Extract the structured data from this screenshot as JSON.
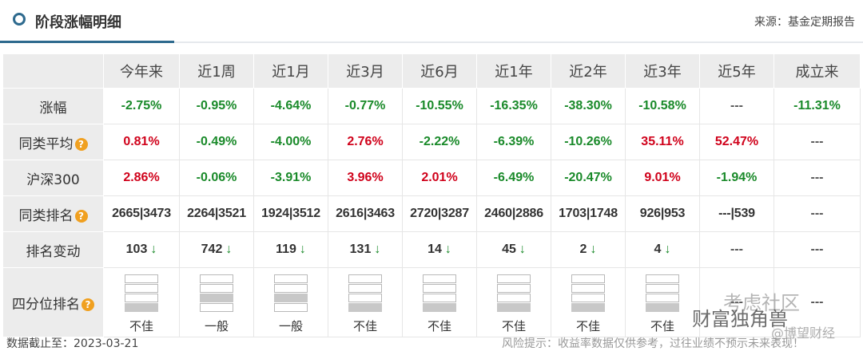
{
  "header": {
    "title": "阶段涨幅明细",
    "source": "来源：基金定期报告"
  },
  "columns": [
    "今年来",
    "近1周",
    "近1月",
    "近3月",
    "近6月",
    "近1年",
    "近2年",
    "近3年",
    "近5年",
    "成立来"
  ],
  "rows": {
    "gain": {
      "label": "涨幅",
      "values": [
        "-2.75%",
        "-0.95%",
        "-4.64%",
        "-0.77%",
        "-10.55%",
        "-16.35%",
        "-38.30%",
        "-10.58%",
        "---",
        "-11.31%"
      ]
    },
    "avg": {
      "label": "同类平均",
      "values": [
        "0.81%",
        "-0.49%",
        "-4.00%",
        "2.76%",
        "-2.22%",
        "-6.39%",
        "-10.26%",
        "35.11%",
        "52.47%",
        "---"
      ]
    },
    "hs300": {
      "label": "沪深300",
      "values": [
        "2.86%",
        "-0.06%",
        "-3.91%",
        "3.96%",
        "2.01%",
        "-6.49%",
        "-20.47%",
        "9.01%",
        "-1.94%",
        "---"
      ]
    },
    "rank": {
      "label": "同类排名",
      "values": [
        "2665|3473",
        "2264|3521",
        "1924|3512",
        "2616|3463",
        "2720|3287",
        "2460|2886",
        "1703|1748",
        "926|953",
        "---|539",
        "---"
      ]
    },
    "change": {
      "label": "排名变动",
      "values": [
        "103",
        "742",
        "119",
        "131",
        "14",
        "45",
        "2",
        "4",
        "---",
        "---"
      ],
      "arrow": "↓"
    },
    "quartile": {
      "label": "四分位排名",
      "values": [
        "不佳",
        "一般",
        "一般",
        "不佳",
        "不佳",
        "不佳",
        "不佳",
        "不佳",
        "---",
        "---"
      ]
    }
  },
  "footer": {
    "date": "数据截止至：2023-03-21",
    "risk": "风险提示：收益率数据仅供参考，过往业绩不预示未来表现！"
  },
  "watermark": {
    "line1": "考虑社区",
    "line2": "财富独角兽",
    "line3": "@博望财经"
  },
  "colors": {
    "negative": "#1a8a2a",
    "positive": "#d0021b",
    "accent": "#2e6a8e",
    "help_icon": "#f0a020"
  }
}
